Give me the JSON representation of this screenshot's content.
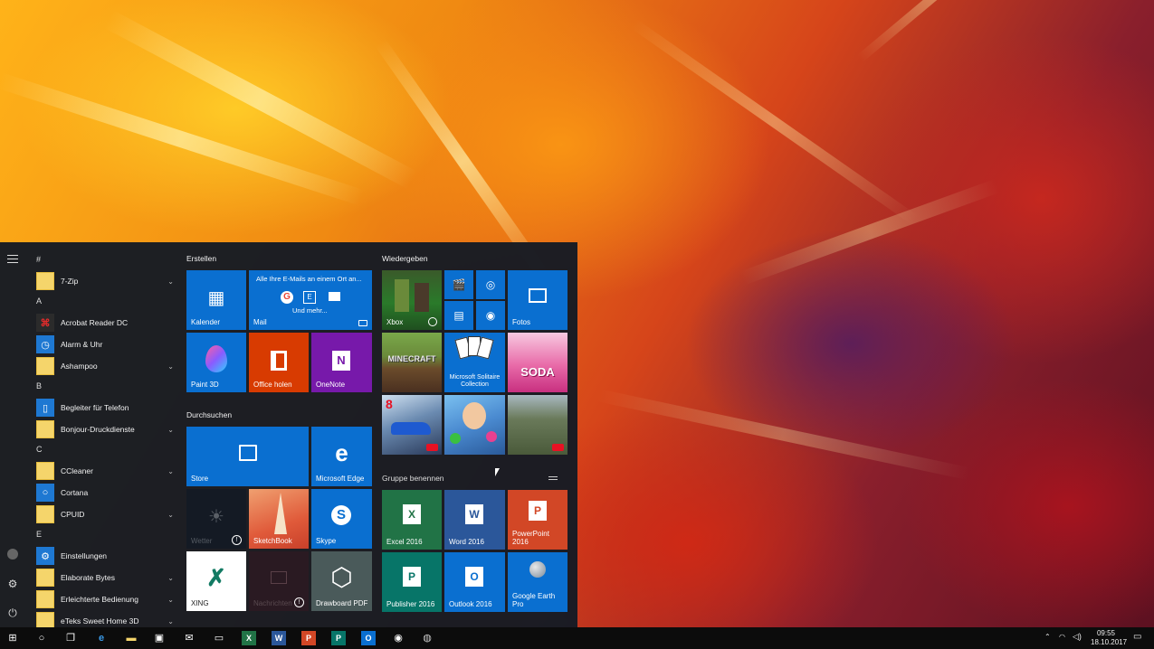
{
  "start_menu": {
    "app_list": [
      {
        "type": "letter",
        "label": "#"
      },
      {
        "type": "app",
        "label": "7-Zip",
        "icon": "folder-icon",
        "expandable": true
      },
      {
        "type": "letter",
        "label": "A"
      },
      {
        "type": "app",
        "label": "Acrobat Reader DC",
        "icon": "acrobat-icon",
        "expandable": false
      },
      {
        "type": "app",
        "label": "Alarm & Uhr",
        "icon": "alarm-icon",
        "expandable": false
      },
      {
        "type": "app",
        "label": "Ashampoo",
        "icon": "folder-icon",
        "expandable": true
      },
      {
        "type": "letter",
        "label": "B"
      },
      {
        "type": "app",
        "label": "Begleiter für Telefon",
        "icon": "phone-icon",
        "expandable": false
      },
      {
        "type": "app",
        "label": "Bonjour-Druckdienste",
        "icon": "folder-icon",
        "expandable": true
      },
      {
        "type": "letter",
        "label": "C"
      },
      {
        "type": "app",
        "label": "CCleaner",
        "icon": "folder-icon",
        "expandable": true
      },
      {
        "type": "app",
        "label": "Cortana",
        "icon": "cortana-icon",
        "expandable": false
      },
      {
        "type": "app",
        "label": "CPUID",
        "icon": "folder-icon",
        "expandable": true
      },
      {
        "type": "letter",
        "label": "E"
      },
      {
        "type": "app",
        "label": "Einstellungen",
        "icon": "settings-icon",
        "expandable": false
      },
      {
        "type": "app",
        "label": "Elaborate Bytes",
        "icon": "folder-icon",
        "expandable": true
      },
      {
        "type": "app",
        "label": "Erleichterte Bedienung",
        "icon": "folder-icon",
        "expandable": true
      },
      {
        "type": "app",
        "label": "eTeks Sweet Home 3D",
        "icon": "folder-icon",
        "expandable": true
      }
    ],
    "groups": {
      "erstellen": "Erstellen",
      "durchsuchen": "Durchsuchen",
      "wiedergeben": "Wiedergeben",
      "unnamed": "Gruppe benennen"
    },
    "tiles": {
      "kalender": "Kalender",
      "mail": "Mail",
      "mail_preview": "Alle Ihre E-Mails an einem Ort an...",
      "mail_more": "Und mehr...",
      "paint3d": "Paint 3D",
      "office": "Office holen",
      "onenote": "OneNote",
      "store": "Store",
      "edge": "Microsoft Edge",
      "wetter": "Wetter",
      "sketchbook": "SketchBook",
      "skype": "Skype",
      "xing": "XING",
      "nachrichten": "Nachrichten",
      "drawboard": "Drawboard PDF",
      "xbox": "Xbox",
      "fotos": "Fotos",
      "minecraft": "MINECRAFT",
      "solitaire": "Microsoft Solitaire Collection",
      "soda": "SODA",
      "excel": "Excel 2016",
      "word": "Word 2016",
      "powerpoint": "PowerPoint 2016",
      "publisher": "Publisher 2016",
      "outlook": "Outlook 2016",
      "google_earth": "Google Earth Pro"
    }
  },
  "taskbar": {
    "time": "09:55",
    "date": "18.10.2017"
  },
  "colors": {
    "tile_blue": "#0a6fd0",
    "office_red": "#d83b01",
    "onenote_purple": "#7719aa",
    "excel_green": "#217346",
    "word_blue": "#2b579a",
    "powerpoint_red": "#d24726",
    "publisher_teal": "#077568",
    "menu_bg": "#161b24"
  }
}
